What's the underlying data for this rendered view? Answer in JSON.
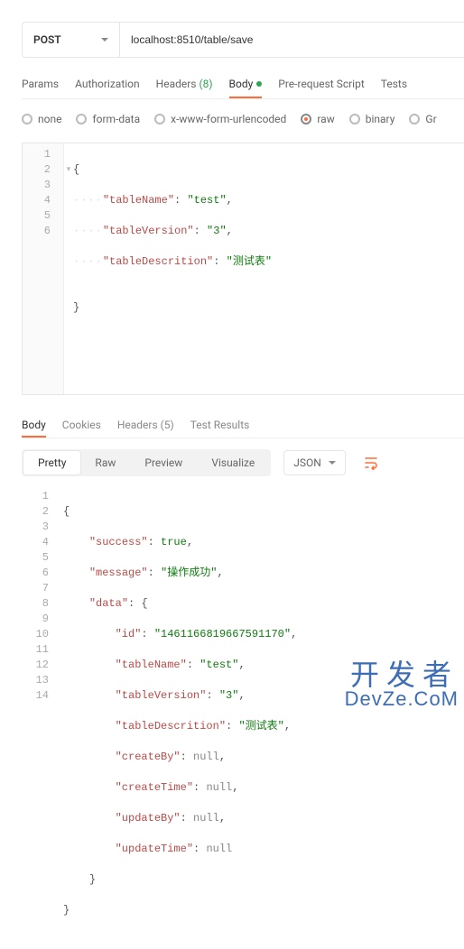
{
  "urlbar": {
    "method": "POST",
    "url": "localhost:8510/table/save"
  },
  "req_tabs": {
    "params": "Params",
    "auth": "Authorization",
    "headers": "Headers",
    "headers_count": "(8)",
    "body": "Body",
    "prereq": "Pre-request Script",
    "tests": "Tests"
  },
  "body_types": {
    "none": "none",
    "formdata": "form-data",
    "urlencoded": "x-www-form-urlencoded",
    "raw": "raw",
    "binary": "binary",
    "graphql": "Gr"
  },
  "request_body": {
    "lines": [
      "1",
      "2",
      "3",
      "4",
      "5",
      "6"
    ],
    "code": {
      "l1": "{",
      "k2": "\"tableName\"",
      "v2": "\"test\"",
      "k3": "\"tableVersion\"",
      "v3": "\"3\"",
      "k4": "\"tableDescrition\"",
      "v4": "\"测试表\"",
      "l6": "}"
    }
  },
  "resp_tabs": {
    "body": "Body",
    "cookies": "Cookies",
    "headers": "Headers",
    "headers_count": "(5)",
    "results": "Test Results"
  },
  "view": {
    "pretty": "Pretty",
    "raw": "Raw",
    "preview": "Preview",
    "visualize": "Visualize",
    "lang": "JSON"
  },
  "response_body": {
    "lines": [
      "1",
      "2",
      "3",
      "4",
      "5",
      "6",
      "7",
      "8",
      "9",
      "10",
      "11",
      "12",
      "13",
      "14"
    ],
    "code": {
      "l1": "{",
      "k2": "\"success\"",
      "v2": "true",
      "k3": "\"message\"",
      "v3": "\"操作成功\"",
      "k4": "\"data\"",
      "v4": "{",
      "k5": "\"id\"",
      "v5": "\"1461166819667591170\"",
      "k6": "\"tableName\"",
      "v6": "\"test\"",
      "k7": "\"tableVersion\"",
      "v7": "\"3\"",
      "k8": "\"tableDescrition\"",
      "v8": "\"测试表\"",
      "k9": "\"createBy\"",
      "v9": "null",
      "k10": "\"createTime\"",
      "v10": "null",
      "k11": "\"updateBy\"",
      "v11": "null",
      "k12": "\"updateTime\"",
      "v12": "null",
      "l13": "}",
      "l14": "}"
    }
  },
  "watermark": {
    "line1": "开发者",
    "line2": "DevZe.CoM"
  }
}
